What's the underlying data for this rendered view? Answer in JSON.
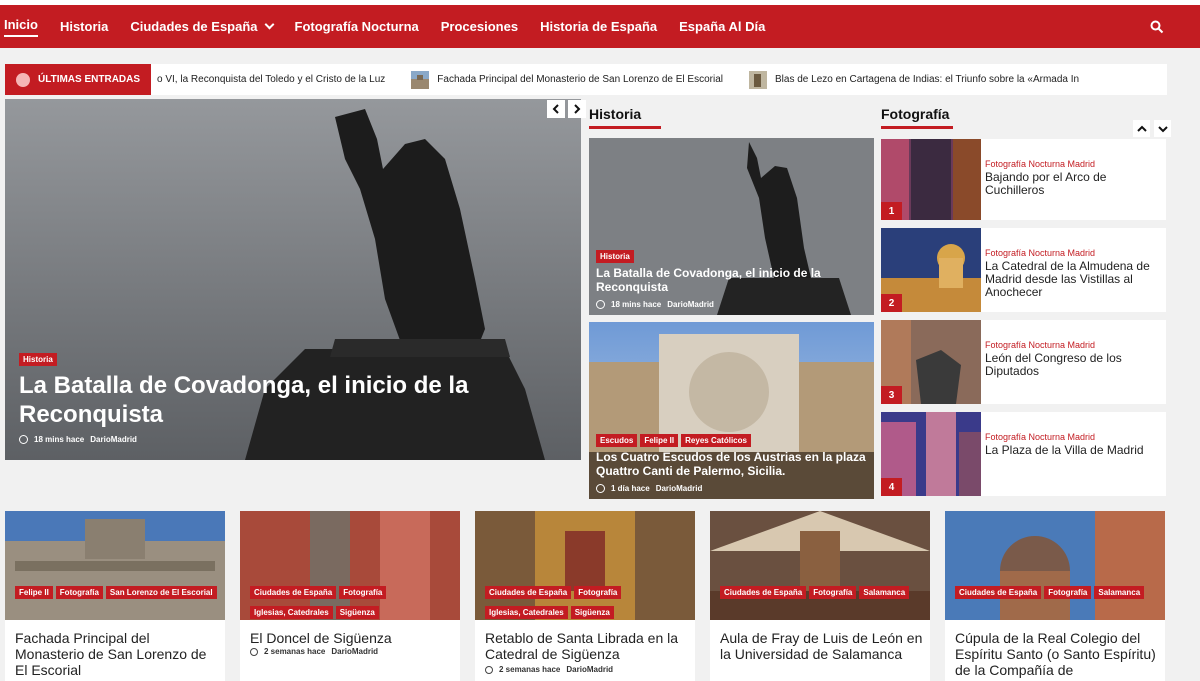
{
  "nav": {
    "items": [
      "Inicio",
      "Historia",
      "Ciudades de España",
      "Fotografía Nocturna",
      "Procesiones",
      "Historia de España",
      "España Al Día"
    ],
    "accent": "#c31c22"
  },
  "ticker": {
    "label": "ÚLTIMAS ENTRADAS",
    "items": [
      "o VI, la Reconquista del Toledo y el Cristo de la Luz",
      "Fachada Principal del Monasterio de San Lorenzo de El Escorial",
      "Blas de Lezo en Cartagena de Indias: el Triunfo sobre la «Armada In"
    ]
  },
  "hero": {
    "category": "Historia",
    "title": "La Batalla de Covadonga, el inicio de la Reconquista",
    "time": "18 mins hace",
    "author": "DarioMadrid"
  },
  "historia": {
    "heading": "Historia",
    "cards": [
      {
        "categories": [
          "Historia"
        ],
        "title": "La Batalla de Covadonga, el inicio de la Reconquista",
        "time": "18 mins hace",
        "author": "DarioMadrid"
      },
      {
        "categories": [
          "Escudos",
          "Felipe II",
          "Reyes Católicos"
        ],
        "title": "Los Cuatro Escudos de los Austrias en la plaza Quattro Canti de Palermo, Sicilia.",
        "time": "1 día hace",
        "author": "DarioMadrid"
      }
    ]
  },
  "fotografia": {
    "heading": "Fotografía",
    "items": [
      {
        "num": "1",
        "category": "Fotografía Nocturna Madrid",
        "title": "Bajando por el Arco de Cuchilleros"
      },
      {
        "num": "2",
        "category": "Fotografía Nocturna Madrid",
        "title": "La Catedral de la Almudena de Madrid desde las Vistillas al Anochecer"
      },
      {
        "num": "3",
        "category": "Fotografía Nocturna Madrid",
        "title": "León del Congreso de los Diputados"
      },
      {
        "num": "4",
        "category": "Fotografía Nocturna Madrid",
        "title": "La Plaza de la Villa de Madrid"
      }
    ]
  },
  "bottom": [
    {
      "categories": [
        "Felipe II",
        "Fotografía",
        "San Lorenzo de El Escorial"
      ],
      "title": "Fachada Principal del Monasterio de San Lorenzo de El Escorial",
      "time": "",
      "author": ""
    },
    {
      "categories": [
        "Ciudades de España",
        "Fotografía",
        "Iglesias, Catedrales",
        "Sigüenza"
      ],
      "title": "El Doncel de Sigüenza",
      "time": "2 semanas hace",
      "author": "DarioMadrid"
    },
    {
      "categories": [
        "Ciudades de España",
        "Fotografía",
        "Iglesias, Catedrales",
        "Sigüenza"
      ],
      "title": "Retablo de Santa Librada en la Catedral de Sigüenza",
      "time": "2 semanas hace",
      "author": "DarioMadrid"
    },
    {
      "categories": [
        "Ciudades de España",
        "Fotografía",
        "Salamanca"
      ],
      "title": "Aula de Fray de Luis de León en la Universidad de Salamanca",
      "time": "",
      "author": ""
    },
    {
      "categories": [
        "Ciudades de España",
        "Fotografía",
        "Salamanca"
      ],
      "title": "Cúpula de la Real Colegio del Espíritu Santo (o Santo Espíritu) de la Compañía de",
      "time": "",
      "author": ""
    }
  ]
}
